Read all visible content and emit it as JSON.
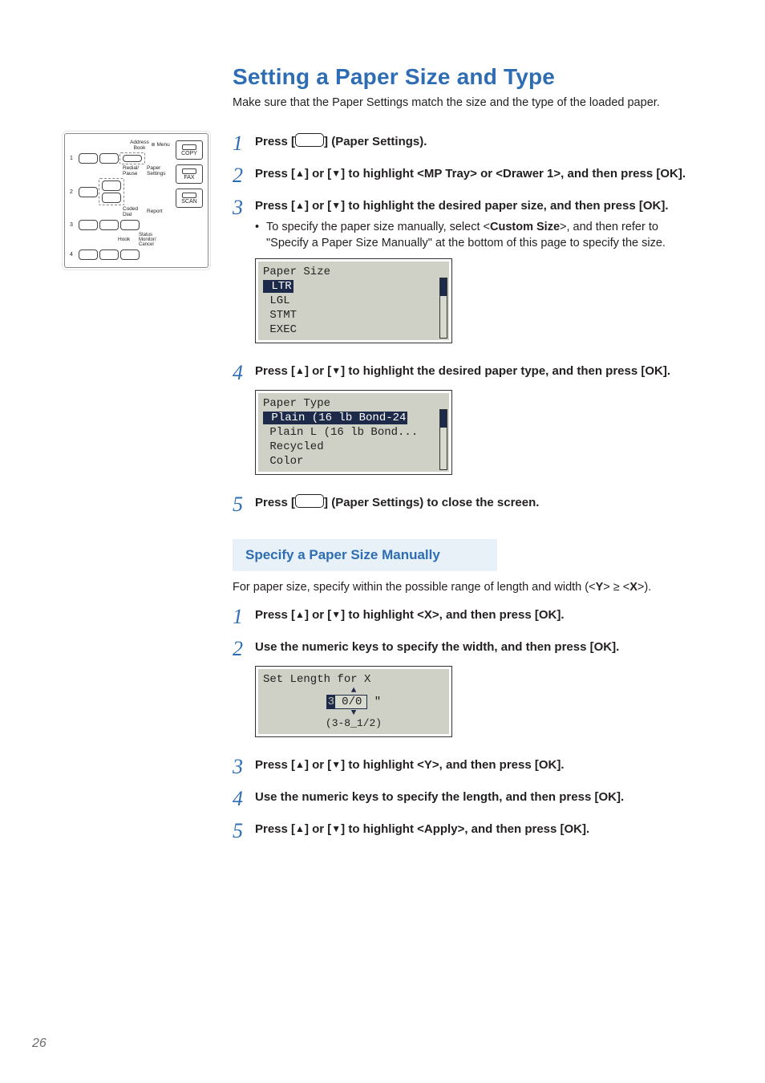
{
  "title": "Setting a Paper Size and Type",
  "intro": "Make sure that the Paper Settings match the size and the type of the loaded paper.",
  "keypad": {
    "col_labels_top": [
      "Address Book",
      "Menu"
    ],
    "row_labels": [
      "1",
      "2",
      "3",
      "4"
    ],
    "mid_labels": [
      "Redial/ Pause",
      "Paper Settings",
      "Coded Dial",
      "Report",
      "Hook",
      "Status Monitor/ Cancel"
    ],
    "side": [
      "COPY",
      "FAX",
      "SCAN"
    ]
  },
  "steps": [
    {
      "n": "1",
      "main_pre": "Press [",
      "main_post": "] (Paper Settings).",
      "icon": true
    },
    {
      "n": "2",
      "main": "Press [▲] or [▼] to highlight <MP Tray> or <Drawer 1>, and then press [OK].",
      "rich": true,
      "parts": [
        "Press [",
        "▲",
        "] or [",
        "▼",
        "] to highlight <",
        "MP Tray",
        "> or <",
        "Drawer 1",
        ">, and then press [OK]."
      ]
    },
    {
      "n": "3",
      "main": "Press [▲] or [▼] to highlight the desired paper size, and then press [OK].",
      "parts": [
        "Press [",
        "▲",
        "] or [",
        "▼",
        "] to highlight the desired paper size, and then press [OK]."
      ],
      "bullet_parts": [
        "To specify the paper size manually, select <",
        "Custom Size",
        ">, and then refer to \"Specify a Paper Size Manually\" at the bottom of this page to specify the size."
      ],
      "lcd": {
        "title": "Paper Size",
        "sel": " LTR",
        "lines": [
          " LGL",
          " STMT",
          " EXEC"
        ]
      }
    },
    {
      "n": "4",
      "main": "Press [▲] or [▼] to highlight the desired paper type, and then press [OK].",
      "parts": [
        "Press [",
        "▲",
        "] or [",
        "▼",
        "] to highlight the desired paper type, and then press [OK]."
      ],
      "lcd": {
        "title": "Paper Type",
        "sel": " Plain (16 lb Bond-24",
        "lines": [
          " Plain L (16 lb Bond...",
          " Recycled",
          " Color"
        ]
      }
    },
    {
      "n": "5",
      "main_pre": "Press [",
      "main_post": "] (Paper Settings) to close the screen.",
      "icon": true
    }
  ],
  "sub": {
    "heading": "Specify a Paper Size Manually",
    "intro_parts": [
      "For paper size, specify within the possible range of length and width (<",
      "Y",
      "> ≥ <",
      "X",
      ">)."
    ],
    "steps": [
      {
        "n": "1",
        "parts": [
          "Press [",
          "▲",
          "] or [",
          "▼",
          "] to highlight <",
          "X",
          ">, and then press [OK]."
        ]
      },
      {
        "n": "2",
        "plain": "Use the numeric keys to specify the width, and then press [OK].",
        "lcd": {
          "title": "Set Length for X",
          "value_cursor": "3",
          "value_rest": "  0/0",
          "unit": "\"",
          "range": "(3-8_1/2)"
        }
      },
      {
        "n": "3",
        "parts": [
          "Press [",
          "▲",
          "] or [",
          "▼",
          "] to highlight <",
          "Y",
          ">, and then press [OK]."
        ]
      },
      {
        "n": "4",
        "plain": "Use the numeric keys to specify the length, and then press [OK]."
      },
      {
        "n": "5",
        "parts": [
          "Press [",
          "▲",
          "] or [",
          "▼",
          "] to highlight <",
          "Apply",
          ">, and then press [OK]."
        ]
      }
    ]
  },
  "pagenum": "26"
}
